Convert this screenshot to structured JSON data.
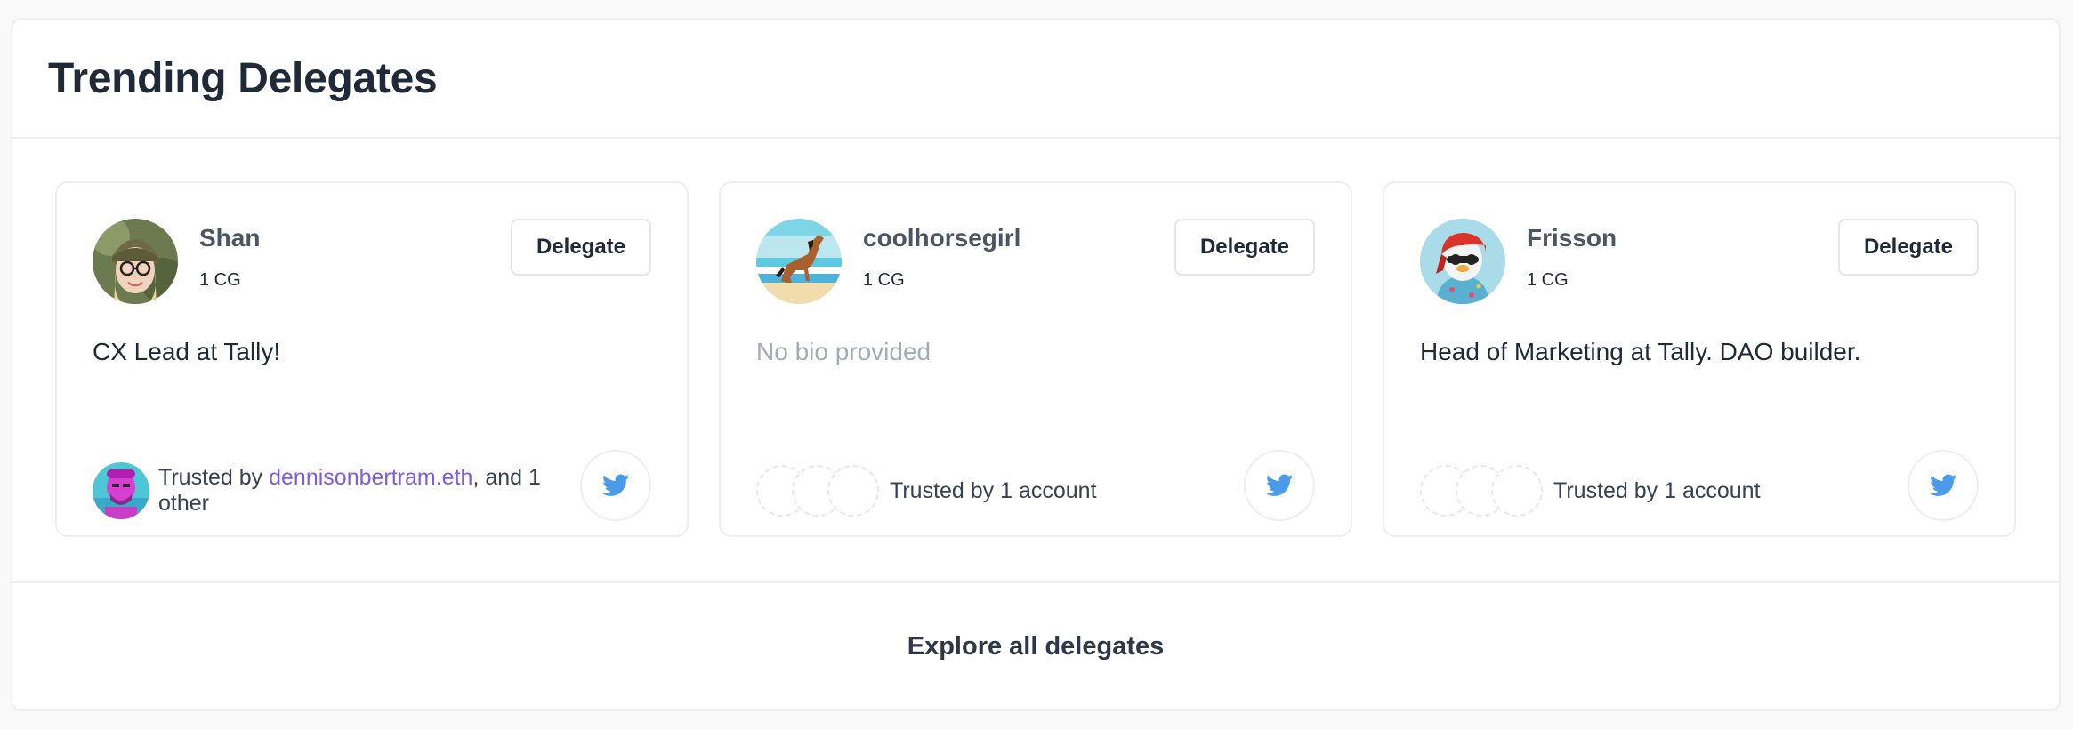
{
  "section": {
    "title": "Trending Delegates",
    "explore_label": "Explore all delegates"
  },
  "delegates": [
    {
      "name": "Shan",
      "votes": "1 CG",
      "delegate_label": "Delegate",
      "bio": "CX Lead at Tally!",
      "bio_empty": false,
      "trust_prefix": "Trusted by ",
      "trust_link": "dennisonbertram.eth",
      "trust_suffix": ", and 1 other"
    },
    {
      "name": "coolhorsegirl",
      "votes": "1 CG",
      "delegate_label": "Delegate",
      "bio": "No bio provided",
      "bio_empty": true,
      "trust_text": "Trusted by 1 account"
    },
    {
      "name": "Frisson",
      "votes": "1 CG",
      "delegate_label": "Delegate",
      "bio": "Head of Marketing at Tally. DAO builder.",
      "bio_empty": false,
      "trust_text": "Trusted by 1 account"
    }
  ],
  "icons": {
    "social": "twitter-icon"
  },
  "colors": {
    "link": "#7b5ce6",
    "twitter": "#4a9be8",
    "muted": "#a3abb7"
  }
}
